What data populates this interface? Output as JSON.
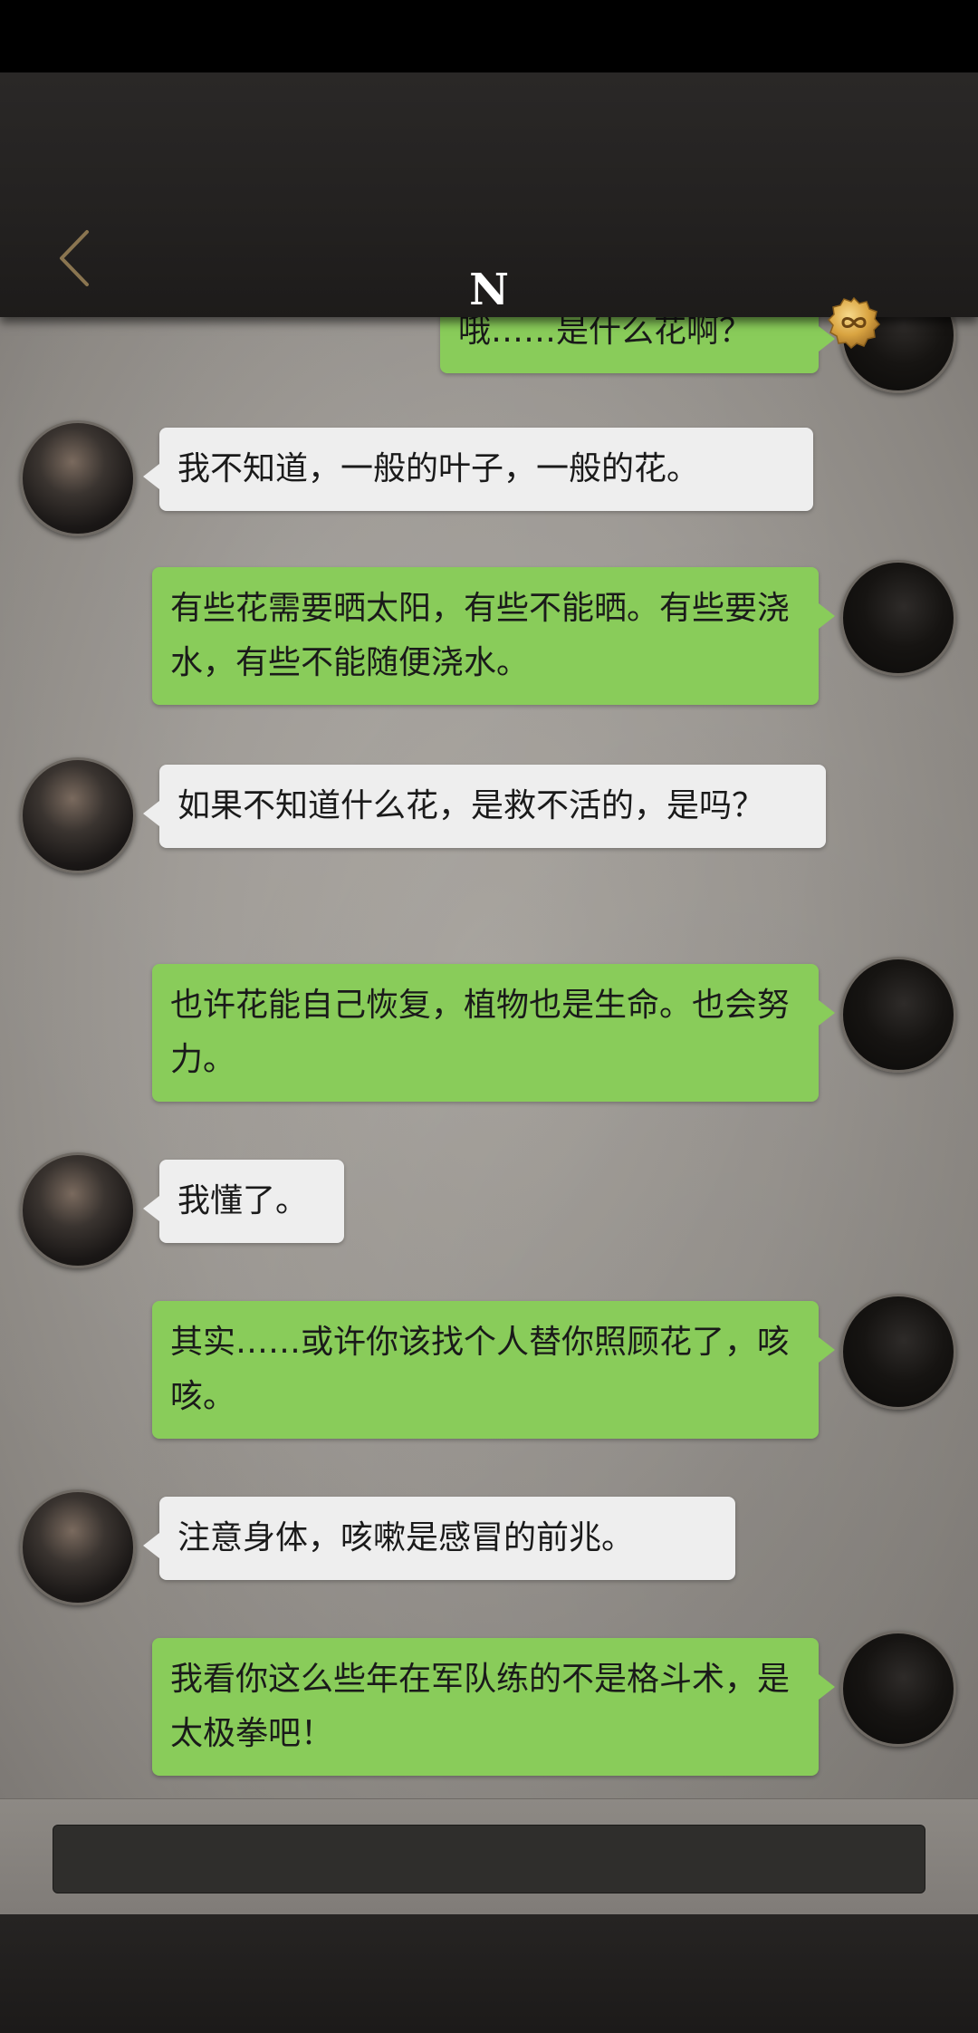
{
  "header": {
    "title": "N"
  },
  "icons": {
    "back": "chevron-left-icon",
    "badge": "infinity-coin-icon"
  },
  "colors": {
    "header_bg": "#232120",
    "chat_bg": "#9c9893",
    "incoming_bubble": "#eeeeee",
    "outgoing_bubble": "#89cc5a",
    "back_chevron": "#8a7550",
    "badge_gold": "#d9a441"
  },
  "messages": [
    {
      "side": "out",
      "text": "哦……是什么花啊？"
    },
    {
      "side": "in",
      "text": "我不知道，一般的叶子，一般的花。"
    },
    {
      "side": "out",
      "text": "有些花需要晒太阳，有些不能晒。有些要浇水，有些不能随便浇水。"
    },
    {
      "side": "in",
      "text": "如果不知道什么花，是救不活的，是吗？"
    },
    {
      "side": "out",
      "text": "也许花能自己恢复，植物也是生命。也会努力。"
    },
    {
      "side": "in",
      "text": "我懂了。"
    },
    {
      "side": "out",
      "text": "其实……或许你该找个人替你照顾花了，咳咳。"
    },
    {
      "side": "in",
      "text": "注意身体，咳嗽是感冒的前兆。"
    },
    {
      "side": "out",
      "text": "我看你这么些年在军队练的不是格斗术，是太极拳吧！"
    }
  ],
  "composer": {
    "value": ""
  }
}
